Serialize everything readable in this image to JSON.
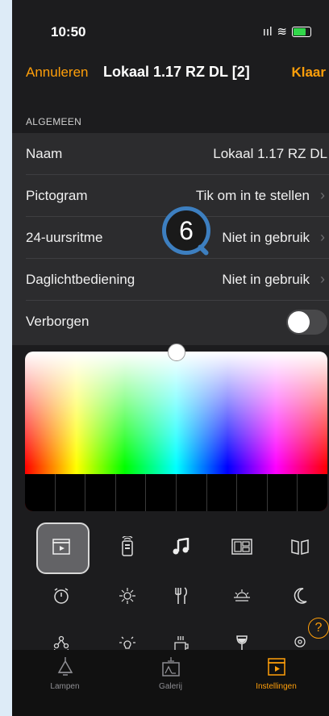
{
  "status": {
    "time": "10:50",
    "signal": "ııl",
    "wifi": "≋"
  },
  "nav": {
    "cancel": "Annuleren",
    "title": "Lokaal 1.17 RZ DL [2]",
    "done": "Klaar"
  },
  "section_header": "ALGEMEEN",
  "rows": [
    {
      "label": "Naam",
      "value": "Lokaal 1.17 RZ DL"
    },
    {
      "label": "Pictogram",
      "value": "Tik om in te stellen"
    },
    {
      "label": "24-uursritme",
      "value": "Niet in gebruik"
    },
    {
      "label": "Daglichtbediening",
      "value": "Niet in gebruik"
    },
    {
      "label": "Verborgen",
      "toggle": false
    }
  ],
  "badge": "6",
  "icons": {
    "row1": [
      "scene-icon",
      "remote-icon",
      "music-note-icon",
      "photo-frame-icon",
      "book-icon"
    ],
    "row2": [
      "timer-icon",
      "sun-icon",
      "cutlery-icon",
      "sunset-icon",
      "moon-icon"
    ],
    "row3": [
      "people-icon",
      "bulb-icon",
      "coffee-icon",
      "wine-glass-icon",
      "location-icon"
    ]
  },
  "help_glyph": "?",
  "tabs": [
    {
      "label": "Lampen",
      "icon": "lamp-icon"
    },
    {
      "label": "Galerij",
      "icon": "gallery-icon"
    },
    {
      "label": "Instellingen",
      "icon": "scene-icon",
      "active": true
    }
  ]
}
